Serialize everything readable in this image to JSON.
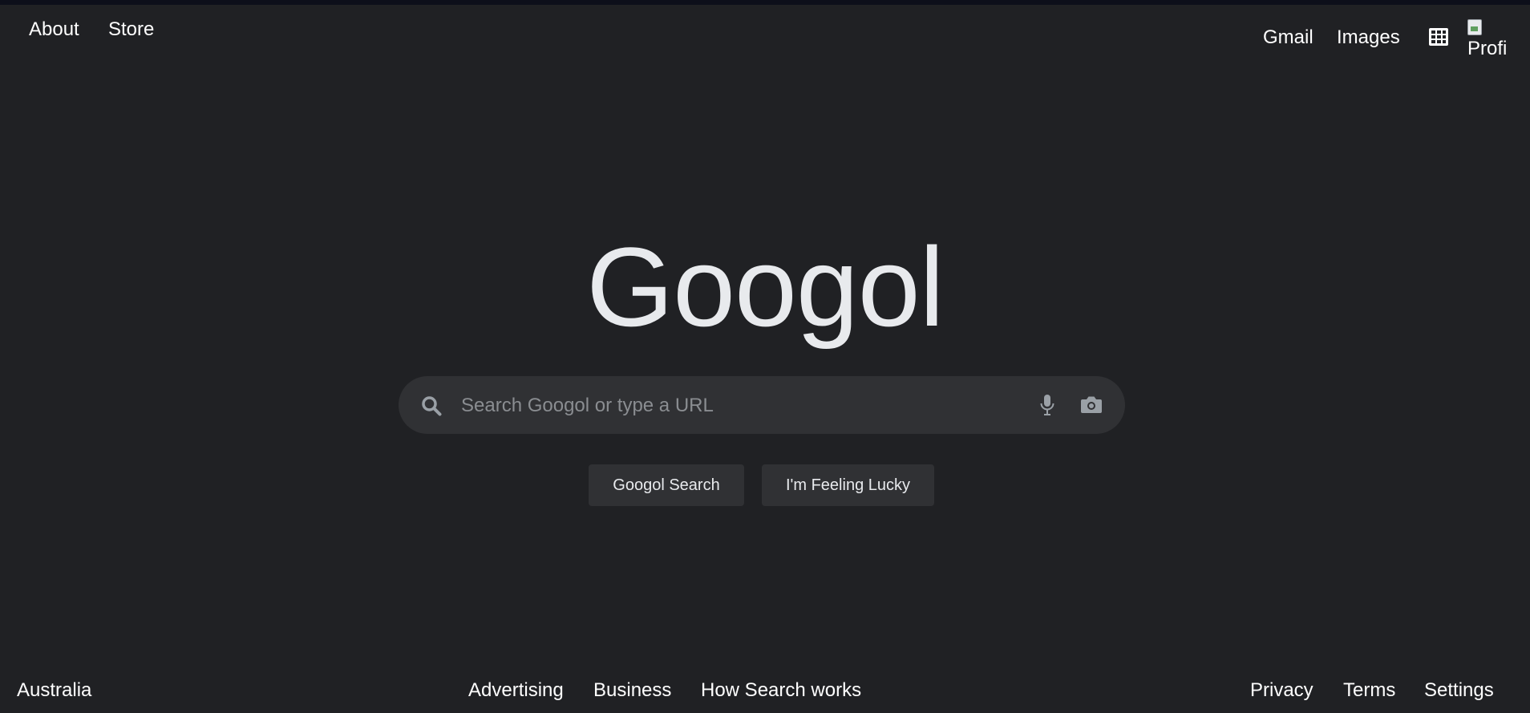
{
  "header": {
    "left_links": [
      "About",
      "Store"
    ],
    "right_links": [
      "Gmail",
      "Images"
    ],
    "apps_icon": "grid-icon",
    "profile_alt": "Profi"
  },
  "logo": {
    "text": "Googol",
    "color": "#e8eaed"
  },
  "search": {
    "placeholder": "Search Googol or type a URL",
    "value": "",
    "icons": [
      "search-icon",
      "microphone-icon",
      "camera-icon"
    ]
  },
  "buttons": {
    "search_label": "Googol Search",
    "lucky_label": "I'm Feeling Lucky"
  },
  "footer": {
    "country": "Australia",
    "center_links": [
      "Advertising",
      "Business",
      "How Search works"
    ],
    "right_links": [
      "Privacy",
      "Terms",
      "Settings"
    ]
  },
  "colors": {
    "background": "#202124",
    "surface": "#303134",
    "text": "#ffffff",
    "muted": "#9aa0a6"
  }
}
